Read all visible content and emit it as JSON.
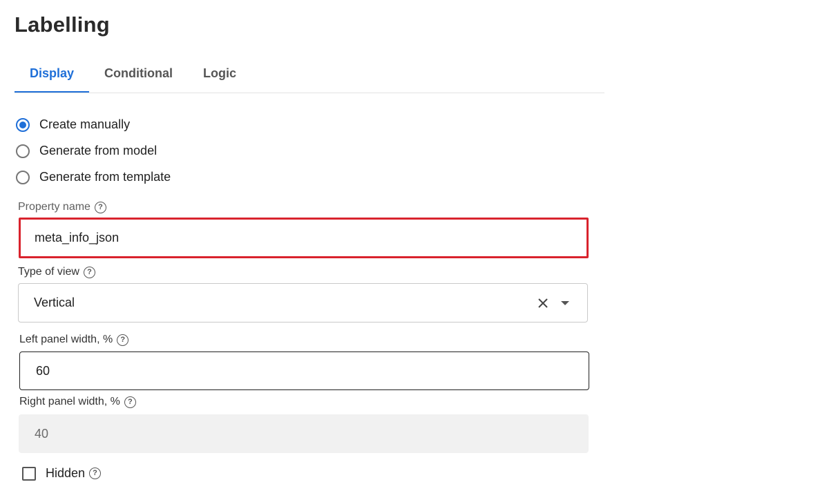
{
  "page": {
    "title": "Labelling"
  },
  "tabs": [
    {
      "label": "Display",
      "active": true
    },
    {
      "label": "Conditional",
      "active": false
    },
    {
      "label": "Logic",
      "active": false
    }
  ],
  "source_options": [
    {
      "label": "Create manually",
      "checked": true
    },
    {
      "label": "Generate from model",
      "checked": false
    },
    {
      "label": "Generate from template",
      "checked": false
    }
  ],
  "property_name": {
    "label": "Property name",
    "value": "meta_info_json"
  },
  "type_of_view": {
    "label": "Type of view",
    "value": "Vertical"
  },
  "left_panel_width": {
    "label": "Left panel width, %",
    "value": "60"
  },
  "right_panel_width": {
    "label": "Right panel width, %",
    "value": "40"
  },
  "hidden": {
    "label": "Hidden",
    "checked": false
  },
  "help_glyph": "?",
  "colors": {
    "accent": "#1f6fd8",
    "highlight": "#d9232d"
  },
  "icons": {
    "help": "help-circle-icon",
    "clear": "close-icon",
    "dropdown": "caret-down-icon"
  }
}
